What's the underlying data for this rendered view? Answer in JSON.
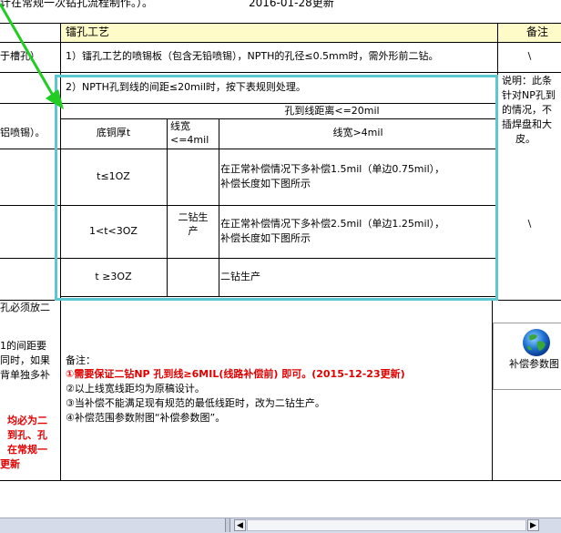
{
  "top_note": {
    "text": "计在常规一次钻孔流程制作。）。",
    "date": "2016-01-28更新"
  },
  "header": {
    "process_col": "镭孔工艺",
    "remarks_col": "备注"
  },
  "left_col": {
    "row1": "于槽孔）",
    "row2": "铝喷锡）。",
    "row3": "孔必须放二",
    "row4_lines": [
      "1的间距要",
      "同时，如果",
      "背单独多补"
    ],
    "row5_red_lines": [
      "均必为二",
      "到孔、孔",
      "在常规一",
      "更新"
    ]
  },
  "process_rows": {
    "rule1": "1）镭孔工艺的喷锡板（包含无铅喷锡），NPTH的孔径≤0.5mm时，需外形前二钻。",
    "rule2": "2）NPTH孔到线的间距≤20mil时，按下表规则处理。"
  },
  "rule_table": {
    "title": "孔到线距离<=20mil",
    "col_copper": "底铜厚t",
    "col_width_small": [
      "线宽",
      "<=4mil"
    ],
    "col_width_large": "线宽>4mil",
    "merged_cell": [
      "二钻生",
      "产"
    ],
    "rows": [
      {
        "copper": "t≤1OZ",
        "text_lines": [
          "在正常补偿情况下多补偿1.5mil（单边0.75mil），",
          "补偿长度如下图所示"
        ]
      },
      {
        "copper": "1<t<3OZ",
        "text_lines": [
          "在正常补偿情况下多补偿2.5mil（单边1.25mil），",
          "补偿长度如下图所示"
        ]
      },
      {
        "copper": "t ≥3OZ",
        "text_lines": [
          "二钻生产"
        ]
      }
    ]
  },
  "remarks": {
    "r1": "\\",
    "r2_lines": [
      "说明：此条",
      "针对NP孔到",
      "的情况，不",
      "插焊盘和大",
      "皮。"
    ],
    "r3": "\\"
  },
  "notes": {
    "title": "备注：",
    "n1": "①需要保证二钻NP 孔到线≥6MIL(线路补偿前) 即可。(2015-12-23更新)",
    "n2": "②以上线宽线距均为原稿设计。",
    "n3": "③当补偿不能满足现有规范的最低线距时，改为二钻生产。",
    "n4": "④补偿范围参数附图“补偿参数图”。"
  },
  "embedded_object": {
    "label": "补偿参数图"
  },
  "colors": {
    "highlight_box": "#5bc8d0",
    "arrow": "#22cc22",
    "header_bg": "#fffbc8",
    "red_text": "#e00000"
  }
}
